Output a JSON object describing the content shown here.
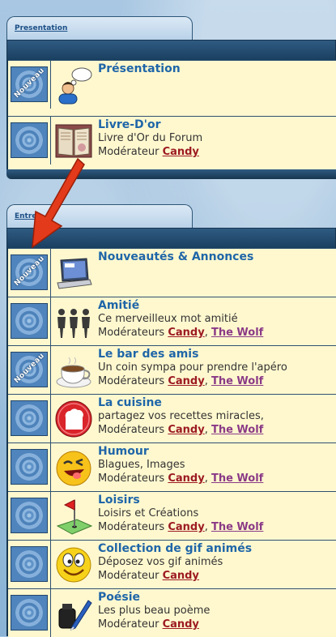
{
  "categories": [
    {
      "tab_label": "Presentation",
      "forums": [
        {
          "title": "Présentation",
          "description": "",
          "mod_label": "",
          "moderators": [],
          "new_posts": true,
          "icon": "user-speech-icon"
        },
        {
          "title": "Livre-D'or",
          "description": "Livre d'Or du Forum",
          "mod_label": "Modérateur",
          "moderators": [
            "Candy"
          ],
          "new_posts": false,
          "icon": "book-icon"
        }
      ]
    },
    {
      "tab_label": "Entre",
      "forums": [
        {
          "title": "Nouveautés & Annonces",
          "description": "",
          "mod_label": "",
          "moderators": [],
          "new_posts": true,
          "icon": "laptop-news-icon"
        },
        {
          "title": "Amitié",
          "description": "Ce merveilleux mot amitié",
          "mod_label": "Modérateurs",
          "moderators": [
            "Candy",
            "The Wolf"
          ],
          "new_posts": false,
          "icon": "people-icon"
        },
        {
          "title": "Le bar des amis",
          "description": "Un coin sympa pour prendre l'apéro",
          "mod_label": "Modérateurs",
          "moderators": [
            "Candy",
            "The Wolf"
          ],
          "new_posts": true,
          "icon": "coffee-cup-icon"
        },
        {
          "title": "La cuisine",
          "description": "partagez vos recettes miracles,",
          "mod_label": "Modérateurs",
          "moderators": [
            "Candy",
            "The Wolf"
          ],
          "new_posts": false,
          "icon": "chef-hat-icon"
        },
        {
          "title": "Humour",
          "description": "Blagues, Images",
          "mod_label": "Modérateurs",
          "moderators": [
            "Candy",
            "The Wolf"
          ],
          "new_posts": false,
          "icon": "laughing-smiley-icon"
        },
        {
          "title": "Loisirs",
          "description": "Loisirs et Créations",
          "mod_label": "Modérateurs",
          "moderators": [
            "Candy",
            "The Wolf"
          ],
          "new_posts": false,
          "icon": "golf-flag-icon"
        },
        {
          "title": "Collection de gif animés",
          "description": "Déposez vos gif animés",
          "mod_label": "Modérateur",
          "moderators": [
            "Candy"
          ],
          "new_posts": false,
          "icon": "smiley-icon"
        },
        {
          "title": "Poésie",
          "description": "Les plus beau poème",
          "mod_label": "Modérateur",
          "moderators": [
            "Candy"
          ],
          "new_posts": false,
          "icon": "ink-pen-icon"
        }
      ]
    }
  ],
  "status_stamp": "Nouveau",
  "colors": {
    "title": "#1f66a8",
    "moderator_1": "#9c1a22",
    "moderator_2": "#8a3a86",
    "row_bg": "#fff8cf",
    "header": "#1a3f60",
    "arrow": "#e23a1a"
  }
}
